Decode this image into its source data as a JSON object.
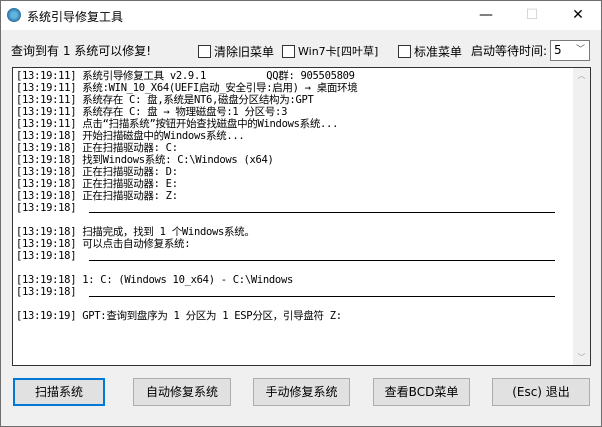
{
  "window": {
    "title": "系统引导修复工具",
    "minimize": "—",
    "maximize": "☐",
    "close": "✕"
  },
  "header": {
    "status": "查询到有 1 系统可以修复!",
    "options": [
      {
        "label": "清除旧菜单",
        "checked": false
      },
      {
        "label": "Win7卡[四叶草]",
        "checked": false
      },
      {
        "label": "标准菜单",
        "checked": false
      }
    ],
    "wait_label": "启动等待时间:",
    "wait_value": "5"
  },
  "log": [
    {
      "text": "[13:19:11] 系统引导修复工具 v2.9.1          QQ群: 905505809"
    },
    {
      "text": "[13:19:11] 系统:WIN_10_X64(UEFI启动_安全引导:启用) → 桌面环境"
    },
    {
      "text": "[13:19:11] 系统存在 C: 盘,系统是NT6,磁盘分区结构为:GPT"
    },
    {
      "text": "[13:19:11] 系统存在 C: 盘 → 物理磁盘号:1 分区号:3"
    },
    {
      "text": "[13:19:11] 点击“扫描系统”按钮开始查找磁盘中的Windows系统..."
    },
    {
      "text": "[13:19:18] 开始扫描磁盘中的Windows系统..."
    },
    {
      "text": "[13:19:18] 正在扫描驱动器: C:"
    },
    {
      "text": "[13:19:18] 找到Windows系统: C:\\Windows (x64)"
    },
    {
      "text": "[13:19:18] 正在扫描驱动器: D:"
    },
    {
      "text": "[13:19:18] 正在扫描驱动器: E:"
    },
    {
      "text": "[13:19:18] 正在扫描驱动器: Z:"
    },
    {
      "text": "[13:19:18]",
      "separator": true
    },
    {
      "text": ""
    },
    {
      "text": "[13:19:18] 扫描完成，找到 1 个Windows系统。"
    },
    {
      "text": "[13:19:18] 可以点击自动修复系统:"
    },
    {
      "text": "[13:19:18]",
      "separator": true
    },
    {
      "text": ""
    },
    {
      "text": "[13:19:18] 1: C: (Windows 10_x64) - C:\\Windows"
    },
    {
      "text": "[13:19:18]",
      "separator": true
    },
    {
      "text": ""
    },
    {
      "text": "[13:19:19] GPT:查询到盘序为 1 分区为 1 ESP分区，引导盘符 Z:"
    }
  ],
  "buttons": [
    "扫描系统",
    "自动修复系统",
    "手动修复系统",
    "查看BCD菜单",
    "(Esc) 退出"
  ]
}
